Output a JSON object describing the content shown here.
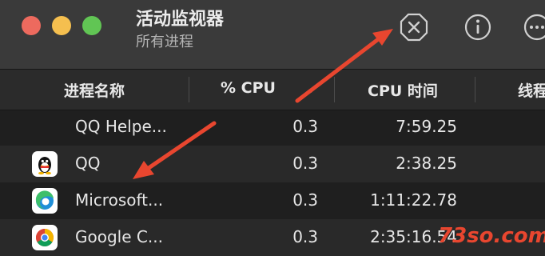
{
  "window": {
    "title": "活动监视器",
    "subtitle": "所有进程",
    "traffic_lights": {
      "close": "#ed6a5e",
      "minimize": "#f5bf4f",
      "zoom": "#61c554"
    }
  },
  "toolbar": {
    "stop_icon": "x-circle-icon",
    "info_icon": "info-icon",
    "more_icon": "ellipsis-icon"
  },
  "table": {
    "columns": {
      "name": "进程名称",
      "cpu": "% CPU",
      "cpu_time": "CPU 时间",
      "threads": "线程"
    },
    "sort": {
      "column": "cpu",
      "direction": "descending"
    },
    "rows": [
      {
        "name": "QQ Helpe...",
        "cpu": "0.3",
        "cpu_time": "7:59.25",
        "icon": "none"
      },
      {
        "name": "QQ",
        "cpu": "0.3",
        "cpu_time": "2:38.25",
        "icon": "qq-penguin-icon"
      },
      {
        "name": "Microsoft...",
        "cpu": "0.3",
        "cpu_time": "1:11:22.78",
        "icon": "edge-icon"
      },
      {
        "name": "Google C...",
        "cpu": "0.3",
        "cpu_time": "2:35:16.54",
        "icon": "chrome-icon"
      }
    ]
  },
  "annotations": {
    "arrow_color": "#e8462f",
    "watermark": "73so.com"
  }
}
